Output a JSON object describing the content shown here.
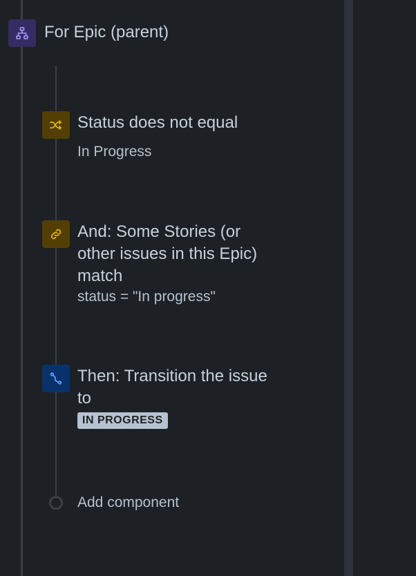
{
  "parent": {
    "label": "For Epic (parent)",
    "icon": "hierarchy-icon",
    "color": "#8270db"
  },
  "steps": [
    {
      "title": "Status does not equal",
      "detail": "In Progress",
      "icon": "shuffle-icon",
      "color": "#e2b203"
    },
    {
      "title_lines": [
        "And: Some Stories (or",
        "other issues in this Epic)",
        "match"
      ],
      "detail": "status = \"In progress\"",
      "icon": "link-icon",
      "color": "#e2b203"
    },
    {
      "title_lines": [
        "Then: Transition the issue",
        "to"
      ],
      "badge": "IN PROGRESS",
      "icon": "transition-icon",
      "color": "#579dff"
    }
  ],
  "add_component": {
    "label": "Add component"
  }
}
